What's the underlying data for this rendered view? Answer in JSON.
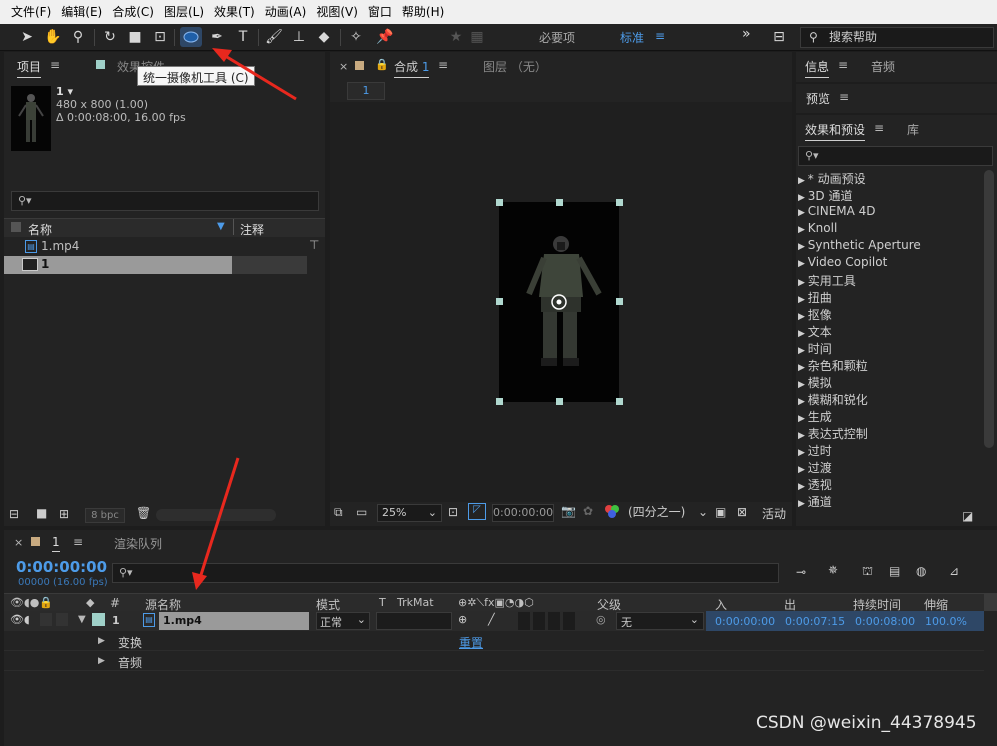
{
  "menu": [
    "文件(F)",
    "编辑(E)",
    "合成(C)",
    "图层(L)",
    "效果(T)",
    "动画(A)",
    "视图(V)",
    "窗口",
    "帮助(H)"
  ],
  "toolbar": {
    "workspace_essentials": "必要项",
    "workspace_standard": "标准",
    "overflow": "»",
    "search_help": "搜索帮助",
    "tooltip": "统一摄像机工具 (C)"
  },
  "project": {
    "tab_project": "项目",
    "tab_effect_controls": "效果控件",
    "comp_name": "1 ▾",
    "comp_dims": "480 x 800 (1.00)",
    "comp_duration": "Δ 0:00:08:00, 16.00 fps",
    "col_name": "名称",
    "col_comment": "注释",
    "items": [
      {
        "name": "1.mp4",
        "kind": "footage"
      },
      {
        "name": "1",
        "kind": "comp"
      }
    ],
    "bpc": "8 bpc"
  },
  "composition": {
    "tab_label": "合成",
    "tab_number": "1",
    "layer_tab": "图层 （无）",
    "comp_chip": "1",
    "zoom": "25%",
    "timecode": "0:00:00:00",
    "resolution": "(四分之一)",
    "active_camera": "活动"
  },
  "right": {
    "tab_info": "信息",
    "tab_audio": "音频",
    "tab_preview": "预览",
    "tab_effects": "效果和预设",
    "tab_library": "库",
    "effects": [
      "* 动画预设",
      "3D 通道",
      "CINEMA 4D",
      "Knoll",
      "Synthetic Aperture",
      "Video Copilot",
      "实用工具",
      "扭曲",
      "抠像",
      "文本",
      "时间",
      "杂色和颗粒",
      "模拟",
      "模糊和锐化",
      "生成",
      "表达式控制",
      "过时",
      "过渡",
      "透视",
      "通道"
    ]
  },
  "timeline": {
    "comp_tab": "1",
    "render_queue": "渲染队列",
    "timecode": "0:00:00:00",
    "frames": "00000 (16.00 fps)",
    "columns": {
      "num": "#",
      "source_name": "源名称",
      "mode": "模式",
      "t": "T",
      "trkmat": "TrkMat",
      "parent": "父级",
      "in": "入",
      "out": "出",
      "duration": "持续时间",
      "stretch": "伸缩"
    },
    "layer": {
      "index": "1",
      "name": "1.mp4",
      "mode": "正常",
      "parent": "无",
      "in": "0:00:00:00",
      "out": "0:00:07:15",
      "duration": "0:00:08:00",
      "stretch": "100.0%"
    },
    "props": [
      {
        "label": "变换",
        "value": "重置"
      },
      {
        "label": "音频",
        "value": ""
      }
    ]
  },
  "watermark": "CSDN @weixin_44378945"
}
